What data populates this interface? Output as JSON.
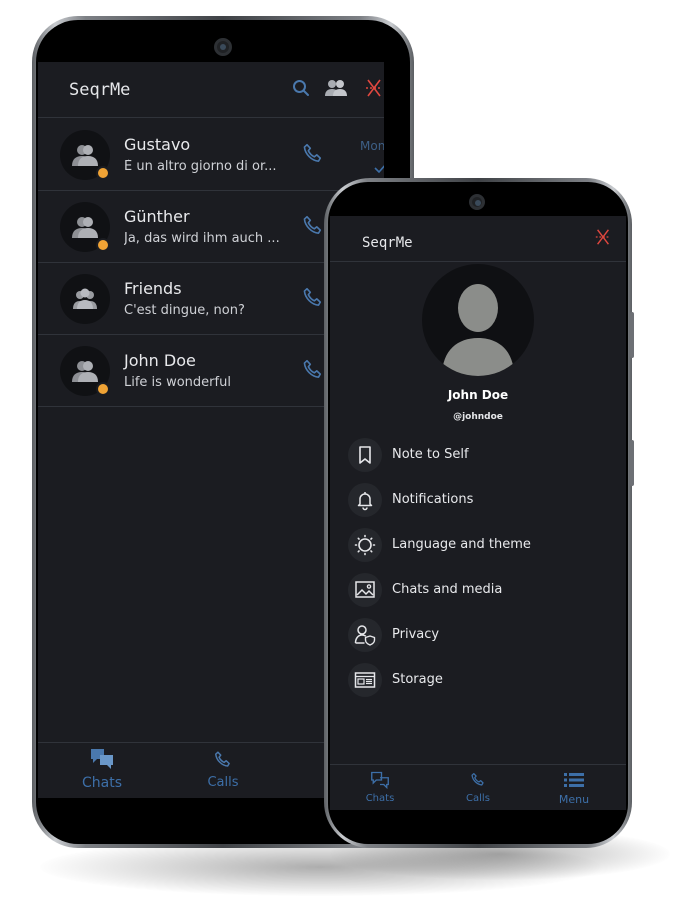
{
  "app": {
    "title": "SeqrMe"
  },
  "chat_list": {
    "items": [
      {
        "name": "Gustavo",
        "message": "È un altro giorno di or...",
        "time": "Mon",
        "avatar": "person-group-icon",
        "online": true,
        "read": true
      },
      {
        "name": "Günther",
        "message": "Ja, das wird ihm auch ...",
        "avatar": "person-group-icon",
        "online": true
      },
      {
        "name": "Friends",
        "message": "C'est dingue, non?",
        "avatar": "group-icon",
        "online": false
      },
      {
        "name": "John Doe",
        "message": "Life is wonderful",
        "avatar": "person-group-icon",
        "online": true
      }
    ]
  },
  "back_nav": {
    "chats": "Chats",
    "calls": "Calls"
  },
  "profile": {
    "name": "John Doe",
    "handle": "@johndoe"
  },
  "menu": {
    "items": [
      {
        "label": "Note to Self",
        "icon": "bookmark-icon"
      },
      {
        "label": "Notifications",
        "icon": "bell-icon"
      },
      {
        "label": "Language and theme",
        "icon": "sun-icon"
      },
      {
        "label": "Chats and media",
        "icon": "image-icon"
      },
      {
        "label": "Privacy",
        "icon": "user-shield-icon"
      },
      {
        "label": "Storage",
        "icon": "storage-icon"
      }
    ]
  },
  "front_nav": {
    "chats": "Chats",
    "calls": "Calls",
    "menu": "Menu"
  },
  "colors": {
    "background": "#1b1c21",
    "accent": "#3d6fa8",
    "status": "#f0a335",
    "logout": "#e0473f"
  }
}
